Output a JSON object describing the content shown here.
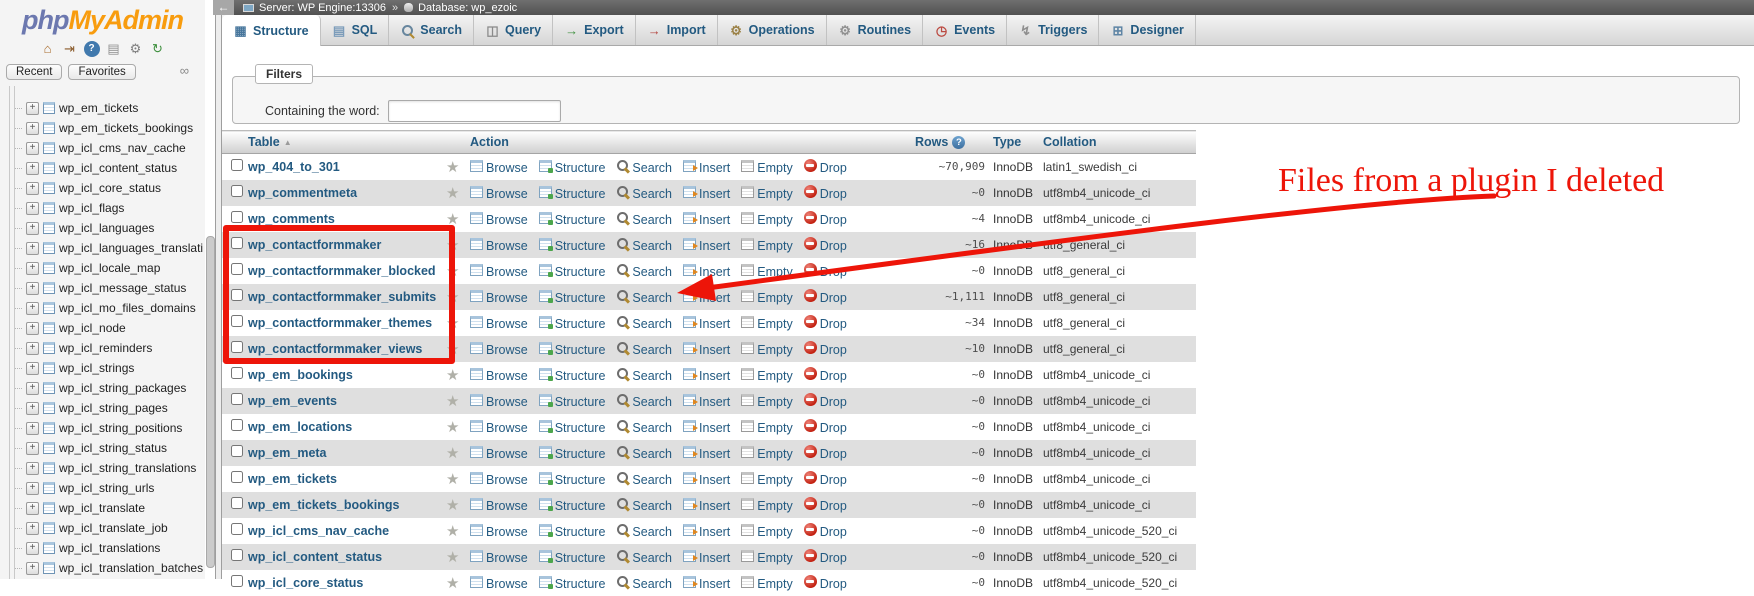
{
  "colors": {
    "accent": "#235a81",
    "annotation_red": "#ed1509",
    "logo_blue": "#6c78af",
    "logo_orange": "#f89c0e",
    "row_stripe": "#dfdfdf"
  },
  "logo": {
    "php": "php",
    "rest": "MyAdmin"
  },
  "sidebar": {
    "header_icons": [
      {
        "name": "home-icon",
        "glyph": "⌂",
        "fg": "#a86a2a"
      },
      {
        "name": "logout-icon",
        "glyph": "⇥",
        "fg": "#8a5a2a"
      },
      {
        "name": "help-icon",
        "glyph": "?",
        "fg": "#ffffff",
        "bg": "#4179ad"
      },
      {
        "name": "docs-icon",
        "glyph": "▤",
        "fg": "#8f8f8f"
      },
      {
        "name": "settings-icon",
        "glyph": "⚙",
        "fg": "#7d7d7d"
      },
      {
        "name": "reload-icon",
        "glyph": "↻",
        "fg": "#3d8f3d"
      }
    ],
    "recent_label": "Recent",
    "favorites_label": "Favorites",
    "link_icon_glyph": "∞",
    "tables": [
      "wp_em_tickets",
      "wp_em_tickets_bookings",
      "wp_icl_cms_nav_cache",
      "wp_icl_content_status",
      "wp_icl_core_status",
      "wp_icl_flags",
      "wp_icl_languages",
      "wp_icl_languages_translati",
      "wp_icl_locale_map",
      "wp_icl_message_status",
      "wp_icl_mo_files_domains",
      "wp_icl_node",
      "wp_icl_reminders",
      "wp_icl_strings",
      "wp_icl_string_packages",
      "wp_icl_string_pages",
      "wp_icl_string_positions",
      "wp_icl_string_status",
      "wp_icl_string_translations",
      "wp_icl_string_urls",
      "wp_icl_translate",
      "wp_icl_translate_job",
      "wp_icl_translations",
      "wp_icl_translation_batches"
    ]
  },
  "server_bar": {
    "back_glyph": "←",
    "server_label": "Server: WP Engine:13306",
    "separator": "»",
    "database_label": "Database: wp_ezoic"
  },
  "tabs": [
    {
      "label": "Structure",
      "icon": "structure-icon",
      "active": true
    },
    {
      "label": "SQL",
      "icon": "sql-icon"
    },
    {
      "label": "Search",
      "icon": "search-icon"
    },
    {
      "label": "Query",
      "icon": "query-icon"
    },
    {
      "label": "Export",
      "icon": "export-icon"
    },
    {
      "label": "Import",
      "icon": "import-icon"
    },
    {
      "label": "Operations",
      "icon": "operations-icon"
    },
    {
      "label": "Routines",
      "icon": "routines-icon"
    },
    {
      "label": "Events",
      "icon": "events-icon"
    },
    {
      "label": "Triggers",
      "icon": "triggers-icon"
    },
    {
      "label": "Designer",
      "icon": "designer-icon"
    }
  ],
  "filters": {
    "legend": "Filters",
    "label": "Containing the word:",
    "value": ""
  },
  "table": {
    "headers": {
      "name": "Table",
      "action": "Action",
      "rows": "Rows",
      "type": "Type",
      "collation": "Collation"
    },
    "action_labels": [
      "Browse",
      "Structure",
      "Search",
      "Insert",
      "Empty",
      "Drop"
    ],
    "rows": [
      {
        "name": "wp_404_to_301",
        "rows": "~70,909",
        "type": "InnoDB",
        "collation": "latin1_swedish_ci"
      },
      {
        "name": "wp_commentmeta",
        "rows": "~0",
        "type": "InnoDB",
        "collation": "utf8mb4_unicode_ci"
      },
      {
        "name": "wp_comments",
        "rows": "~4",
        "type": "InnoDB",
        "collation": "utf8mb4_unicode_ci"
      },
      {
        "name": "wp_contactformmaker",
        "rows": "~16",
        "type": "InnoDB",
        "collation": "utf8_general_ci",
        "highlighted": true
      },
      {
        "name": "wp_contactformmaker_blocked",
        "rows": "~0",
        "type": "InnoDB",
        "collation": "utf8_general_ci",
        "highlighted": true
      },
      {
        "name": "wp_contactformmaker_submits",
        "rows": "~1,111",
        "type": "InnoDB",
        "collation": "utf8_general_ci",
        "highlighted": true
      },
      {
        "name": "wp_contactformmaker_themes",
        "rows": "~34",
        "type": "InnoDB",
        "collation": "utf8_general_ci",
        "highlighted": true
      },
      {
        "name": "wp_contactformmaker_views",
        "rows": "~10",
        "type": "InnoDB",
        "collation": "utf8_general_ci",
        "highlighted": true
      },
      {
        "name": "wp_em_bookings",
        "rows": "~0",
        "type": "InnoDB",
        "collation": "utf8mb4_unicode_ci"
      },
      {
        "name": "wp_em_events",
        "rows": "~0",
        "type": "InnoDB",
        "collation": "utf8mb4_unicode_ci"
      },
      {
        "name": "wp_em_locations",
        "rows": "~0",
        "type": "InnoDB",
        "collation": "utf8mb4_unicode_ci"
      },
      {
        "name": "wp_em_meta",
        "rows": "~0",
        "type": "InnoDB",
        "collation": "utf8mb4_unicode_ci"
      },
      {
        "name": "wp_em_tickets",
        "rows": "~0",
        "type": "InnoDB",
        "collation": "utf8mb4_unicode_ci"
      },
      {
        "name": "wp_em_tickets_bookings",
        "rows": "~0",
        "type": "InnoDB",
        "collation": "utf8mb4_unicode_ci"
      },
      {
        "name": "wp_icl_cms_nav_cache",
        "rows": "~0",
        "type": "InnoDB",
        "collation": "utf8mb4_unicode_520_ci"
      },
      {
        "name": "wp_icl_content_status",
        "rows": "~0",
        "type": "InnoDB",
        "collation": "utf8mb4_unicode_520_ci"
      },
      {
        "name": "wp_icl_core_status",
        "rows": "~0",
        "type": "InnoDB",
        "collation": "utf8mb4_unicode_520_ci",
        "partial": true
      }
    ]
  },
  "annotation": {
    "text": "Files from a plugin I deleted"
  }
}
